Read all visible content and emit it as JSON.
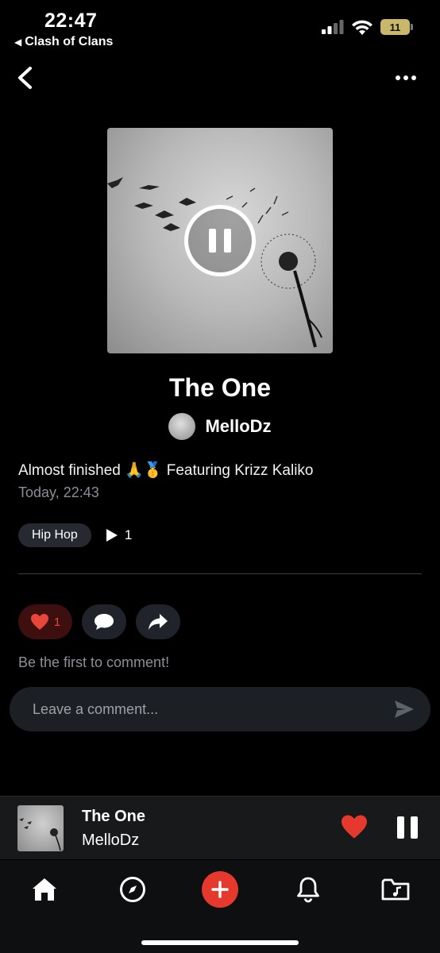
{
  "status_bar": {
    "time": "22:47",
    "back_app": "Clash of Clans",
    "battery": "11"
  },
  "track": {
    "title": "The One",
    "artist": "MelloDz",
    "description": "Almost finished 🙏🥇 Featuring Krizz Kaliko",
    "timestamp": "Today, 22:43",
    "genre": "Hip Hop",
    "plays": "1"
  },
  "actions": {
    "like_count": "1"
  },
  "comments": {
    "empty_text": "Be the first to comment!",
    "placeholder": "Leave a comment..."
  },
  "mini_player": {
    "title": "The One",
    "artist": "MelloDz"
  },
  "colors": {
    "accent": "#e5392d",
    "background": "#000000",
    "muted_text": "#8c8f99"
  },
  "icons": [
    "chevron-left-icon",
    "more-icon",
    "pause-icon",
    "play-icon",
    "heart-icon",
    "comment-icon",
    "share-icon",
    "send-icon",
    "home-icon",
    "compass-icon",
    "plus-icon",
    "bell-icon",
    "music-folder-icon"
  ]
}
